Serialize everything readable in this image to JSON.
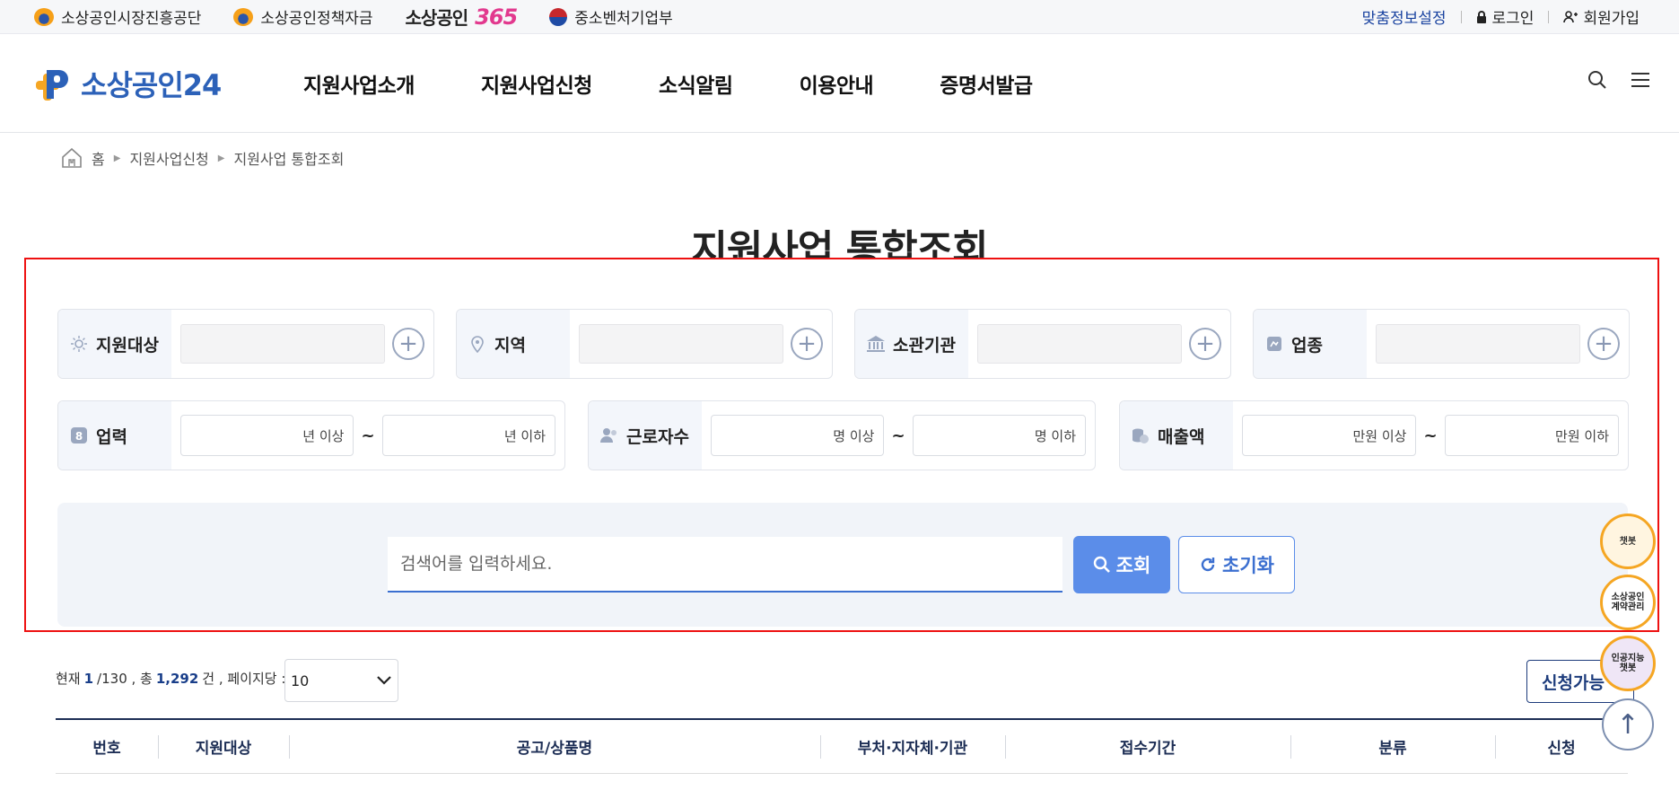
{
  "utility": {
    "sites": [
      {
        "label": "소상공인시장진흥공단",
        "color": "#f6a019"
      },
      {
        "label": "소상공인정책자금",
        "color": "#f6a019"
      },
      {
        "label": "소상공인",
        "num": "365"
      },
      {
        "label": "중소벤처기업부",
        "color": "#c6282d"
      }
    ],
    "custom_info": "맞춤정보설정",
    "login": "로그인",
    "signup": "회원가입"
  },
  "header": {
    "logo_text": "소상공인24",
    "nav": [
      "지원사업소개",
      "지원사업신청",
      "소식알림",
      "이용안내",
      "증명서발급"
    ]
  },
  "breadcrumb": {
    "home": "홈",
    "items": [
      "지원사업신청",
      "지원사업 통합조회"
    ]
  },
  "page_title": "지원사업 통합조회",
  "filters": {
    "row1": [
      {
        "label": "지원대상",
        "icon": "lightbulb-icon"
      },
      {
        "label": "지역",
        "icon": "location-pin-icon"
      },
      {
        "label": "소관기관",
        "icon": "bank-icon"
      },
      {
        "label": "업종",
        "icon": "industry-icon"
      }
    ],
    "row2": [
      {
        "label": "업력",
        "icon": "calendar-badge-icon",
        "from_suffix": "년 이상",
        "to_suffix": "년 이하"
      },
      {
        "label": "근로자수",
        "icon": "people-icon",
        "from_suffix": "명 이상",
        "to_suffix": "명 이하"
      },
      {
        "label": "매출액",
        "icon": "coins-icon",
        "from_suffix": "만원 이상",
        "to_suffix": "만원 이하"
      }
    ],
    "tilde": "~",
    "search_placeholder": "검색어를 입력하세요.",
    "search_button": "조회",
    "reset_button": "초기화"
  },
  "results": {
    "current_label": "현재",
    "current_page": "1",
    "total_pages": "/130 , 총",
    "total_count": "1,292",
    "count_unit": "건 , 페이지당 :",
    "per_page": "10",
    "apply_button": "신청가능"
  },
  "table": {
    "headers": [
      "번호",
      "지원대상",
      "공고/상품명",
      "부처·지자체·기관",
      "접수기간",
      "분류",
      "신청"
    ]
  },
  "floating": {
    "chatbot": "챗봇",
    "contract": "소상공인\n계약관리",
    "ai_chatbot": "인공지능\n챗봇",
    "top": "↑"
  }
}
